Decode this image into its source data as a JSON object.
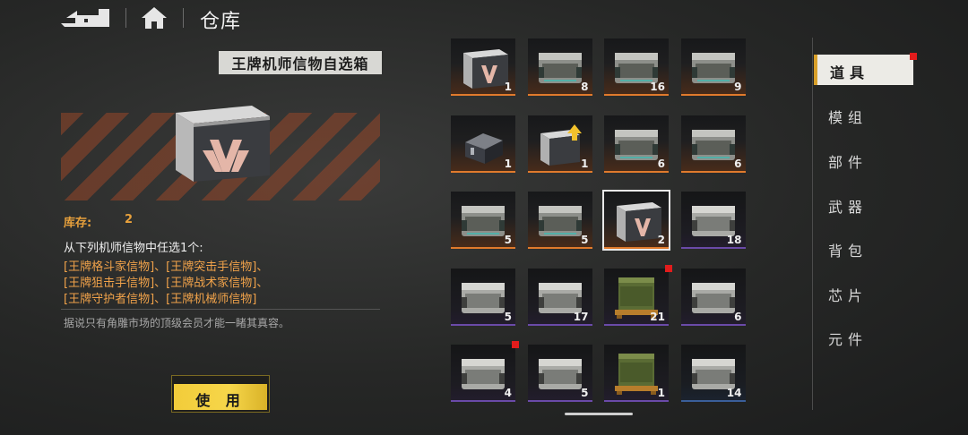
{
  "header": {
    "title": "仓库"
  },
  "detail": {
    "item_name": "王牌机师信物自选箱",
    "stock_label": "库存:",
    "stock_value": "2",
    "desc_intro": "从下列机师信物中任选1个:",
    "desc_lines": [
      "[王牌格斗家信物]、[王牌突击手信物]、",
      "[王牌狙击手信物]、[王牌战术家信物]、",
      "[王牌守护者信物]、[王牌机械师信物]"
    ],
    "flavor": "据说只有角雕市场的顶级会员才能一睹其真容。",
    "use_button": "使 用"
  },
  "colors": {
    "accent_yellow": "#f2cc3a",
    "text_orange": "#f0a24a",
    "rarity_orange": "#e07a2c",
    "rarity_purple": "#6a4aa8",
    "rarity_blue": "#3a5f9a",
    "badge_red": "#e21c1c"
  },
  "grid": {
    "items": [
      {
        "count": "1",
        "icon": "ace-crate-icon",
        "rarity": "orange"
      },
      {
        "count": "8",
        "icon": "steel-chest-icon",
        "rarity": "orange"
      },
      {
        "count": "16",
        "icon": "steel-chest-icon",
        "rarity": "orange"
      },
      {
        "count": "9",
        "icon": "steel-chest-icon",
        "rarity": "orange"
      },
      {
        "count": "1",
        "icon": "black-device-icon",
        "rarity": "orange"
      },
      {
        "count": "1",
        "icon": "upgrade-crate-icon",
        "rarity": "orange"
      },
      {
        "count": "6",
        "icon": "steel-chest-icon",
        "rarity": "orange"
      },
      {
        "count": "6",
        "icon": "steel-chest-icon",
        "rarity": "orange"
      },
      {
        "count": "5",
        "icon": "steel-chest-icon",
        "rarity": "orange"
      },
      {
        "count": "5",
        "icon": "steel-chest-icon",
        "rarity": "orange"
      },
      {
        "count": "2",
        "icon": "ace-crate-icon",
        "rarity": "orange",
        "selected": true
      },
      {
        "count": "18",
        "icon": "silver-chest-icon",
        "rarity": "purple"
      },
      {
        "count": "5",
        "icon": "silver-chest-icon",
        "rarity": "purple"
      },
      {
        "count": "17",
        "icon": "silver-chest-icon",
        "rarity": "purple"
      },
      {
        "count": "21",
        "icon": "military-crate-icon",
        "rarity": "purple",
        "badge": true
      },
      {
        "count": "6",
        "icon": "silver-chest-icon",
        "rarity": "purple"
      },
      {
        "count": "4",
        "icon": "silver-chest-icon",
        "rarity": "purple",
        "badge": true
      },
      {
        "count": "5",
        "icon": "silver-chest-icon",
        "rarity": "purple"
      },
      {
        "count": "1",
        "icon": "military-crate-icon",
        "rarity": "purple"
      },
      {
        "count": "14",
        "icon": "silver-chest-icon",
        "rarity": "blue"
      }
    ]
  },
  "nav": {
    "tabs": [
      {
        "label": "道具",
        "active": true,
        "badge": true
      },
      {
        "label": "模组"
      },
      {
        "label": "部件"
      },
      {
        "label": "武器"
      },
      {
        "label": "背包"
      },
      {
        "label": "芯片"
      },
      {
        "label": "元件"
      }
    ]
  }
}
